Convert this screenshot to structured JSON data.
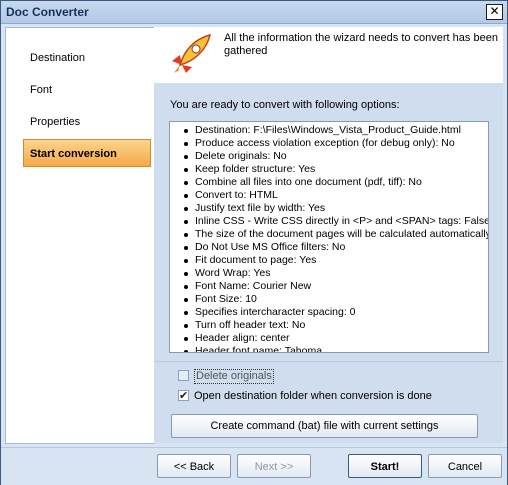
{
  "window": {
    "title": "Doc Converter",
    "close_glyph": "✕"
  },
  "sidebar": {
    "items": [
      {
        "label": "Destination",
        "active": false
      },
      {
        "label": "Font",
        "active": false
      },
      {
        "label": "Properties",
        "active": false
      },
      {
        "label": "Start conversion",
        "active": true
      }
    ]
  },
  "header": {
    "icon": "rocket-icon",
    "text": "All the information the wizard needs to convert has been gathered"
  },
  "main": {
    "ready_text": "You are ready to convert with following options:",
    "options": [
      "Destination: F:\\Files\\Windows_Vista_Product_Guide.html",
      "Produce access violation exception (for debug only): No",
      "Delete originals: No",
      "Keep folder structure: Yes",
      "Combine all files into one document (pdf, tiff): No",
      "Convert to: HTML",
      "Justify text file by width: Yes",
      "Inline CSS - Write CSS directly in <P> and <SPAN> tags: False",
      "The size of the document pages will be calculated automatically",
      "Do Not Use MS Office filters: No",
      "Fit document to page: Yes",
      "Word Wrap: Yes",
      "Font Name: Courier New",
      "Font Size: 10",
      "Specifies intercharacter spacing: 0",
      "Turn off header text: No",
      "Header align: center",
      "Header font name: Tahoma"
    ]
  },
  "bottom": {
    "delete_originals": {
      "label": "Delete originals",
      "checked": false,
      "enabled": false
    },
    "open_folder": {
      "label": "Open destination folder when conversion is done",
      "checked": true
    },
    "create_bat_label": "Create command (bat) file with current settings"
  },
  "footer": {
    "back_label": "<< Back",
    "next_label": "Next >>",
    "start_label": "Start!",
    "cancel_label": "Cancel"
  }
}
